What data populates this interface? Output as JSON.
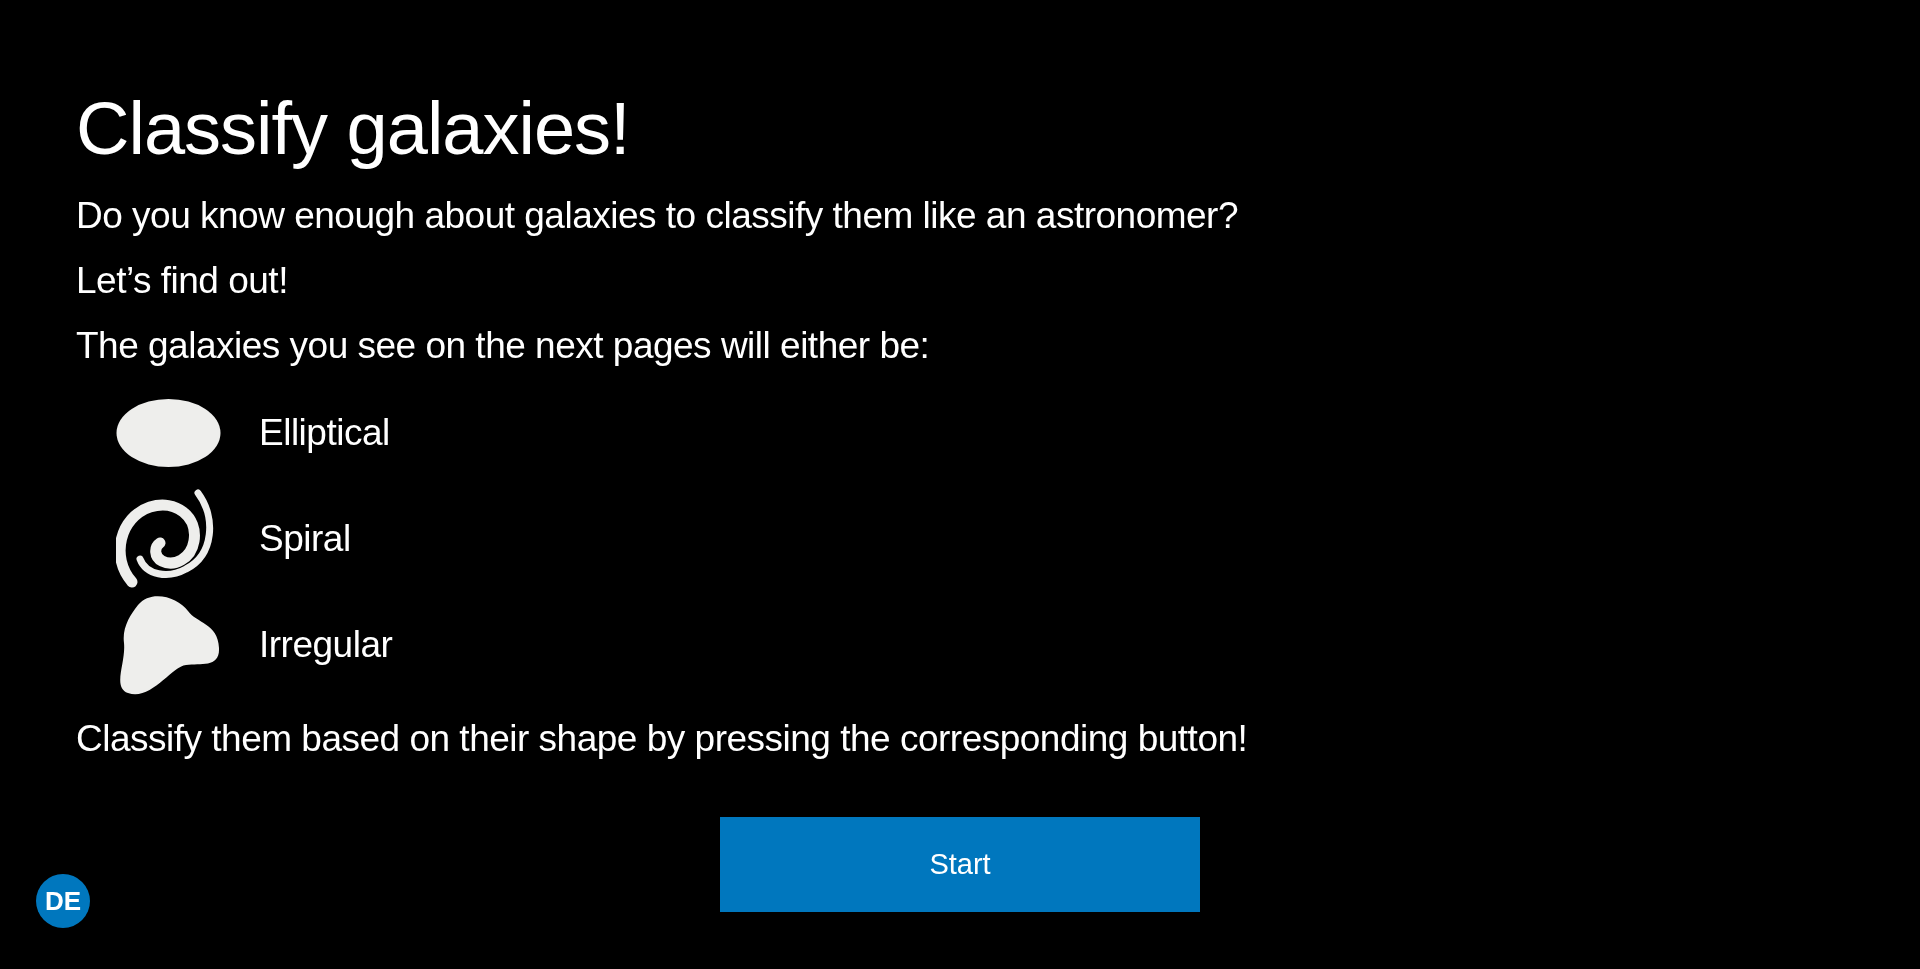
{
  "title": "Classify galaxies!",
  "intro": [
    "Do you know enough about galaxies to classify them like an astronomer?",
    "Let’s find out!",
    "The galaxies you see on the next pages will either be:"
  ],
  "galaxy_types": [
    {
      "kind": "elliptical",
      "label": "Elliptical"
    },
    {
      "kind": "spiral",
      "label": "Spiral"
    },
    {
      "kind": "irregular",
      "label": "Irregular"
    }
  ],
  "instruction": "Classify them based on their shape by pressing the corresponding button!",
  "start_button": "Start",
  "language_button": "DE"
}
